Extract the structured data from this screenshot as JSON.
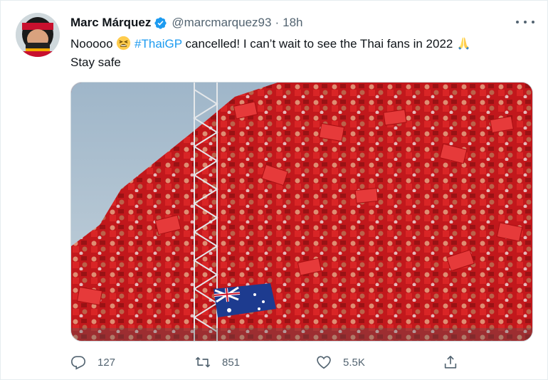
{
  "author": {
    "name": "Marc Márquez",
    "handle": "@marcmarquez93",
    "separator": "·",
    "time": "18h",
    "verified": true,
    "avatar_icon": "avatar-photo"
  },
  "tweet": {
    "text_part1": "Nooooo",
    "emoji1": "tired-face-emoji",
    "hashtag": "#ThaiGP",
    "text_part2": "cancelled! I can’t wait to see the Thai fans in 2022",
    "emoji2": "folded-hands-emoji",
    "text_line2": "Stay safe"
  },
  "media": {
    "icon": "photo-crowd-red-flags"
  },
  "actions": {
    "reply_count": "127",
    "retweet_count": "851",
    "like_count": "5.5K"
  },
  "colors": {
    "accent": "#1d9bf0",
    "secondary_text": "#536471",
    "crowd_red": "#c61d20"
  }
}
